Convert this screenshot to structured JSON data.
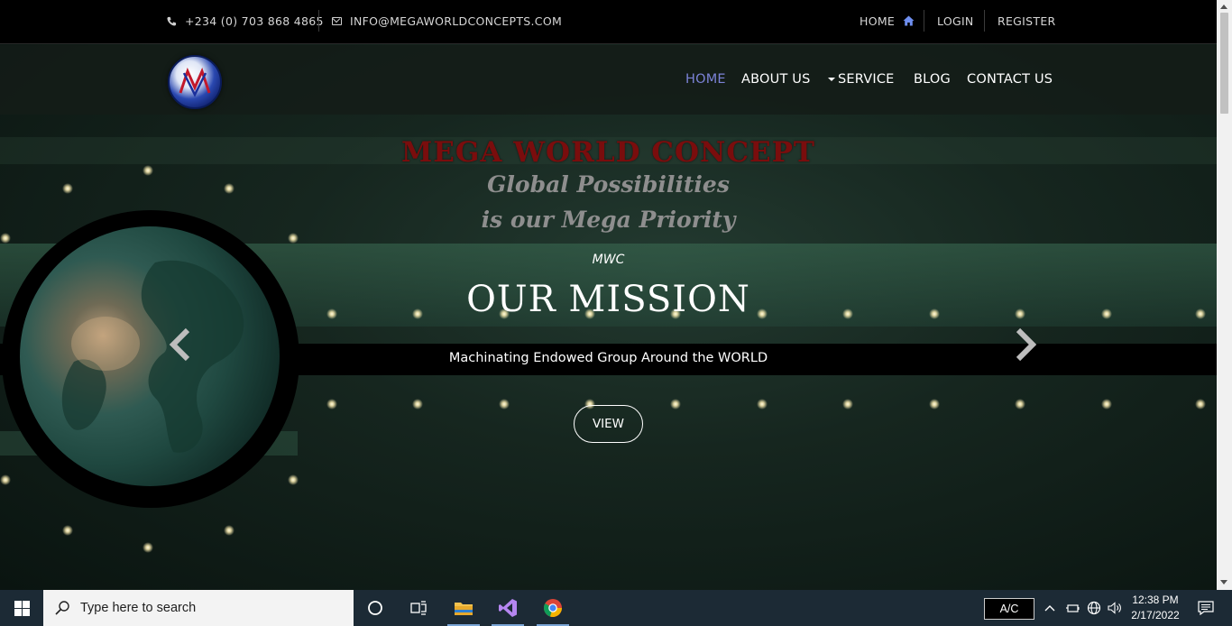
{
  "topbar": {
    "phone": "+234 (0) 703 868 4865",
    "email": "INFO@MEGAWORLDCONCEPTS.COM",
    "home": "HOME",
    "login": "LOGIN",
    "register": "REGISTER"
  },
  "nav": {
    "items": [
      {
        "label": "HOME",
        "active": true
      },
      {
        "label": "ABOUT US"
      },
      {
        "label": "SERVICE"
      },
      {
        "label": "BLOG"
      },
      {
        "label": "CONTACT US"
      }
    ]
  },
  "hero": {
    "brand": "MEGA WORLD CONCEPT",
    "tagline_1": "Global Possibilities",
    "tagline_2": "is our Mega Priority",
    "kicker": "MWC",
    "title": "OUR MISSION",
    "subtitle": "Machinating Endowed Group Around the WORLD",
    "button": "VIEW"
  },
  "taskbar": {
    "search_placeholder": "Type here to search",
    "tray_label": "A/C",
    "time": "12:38 PM",
    "date": "2/17/2022"
  },
  "colors": {
    "nav_active": "#7b82d6",
    "brand_red": "#7a0d0d",
    "taskbar": "#1c2a35"
  }
}
